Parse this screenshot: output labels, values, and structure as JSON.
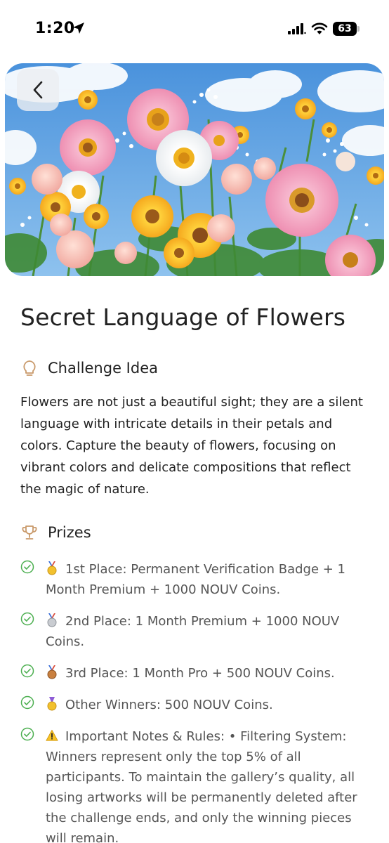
{
  "status_bar": {
    "time": "1:20",
    "battery": "63"
  },
  "header": {
    "back_label": "<"
  },
  "title": "Secret Language of Flowers",
  "challenge": {
    "heading": "Challenge Idea",
    "icon": "lightbulb-icon",
    "description": "Flowers are not just a beautiful sight; they are a silent language with intricate details in their petals and colors. Capture the beauty of flowers, focusing on vibrant colors and delicate compositions that reflect the magic of nature."
  },
  "prizes": {
    "heading": "Prizes",
    "icon": "trophy-icon",
    "items": [
      {
        "icon": "gold-medal-icon",
        "text": "1st Place: Permanent Verification Badge + 1 Month Premium + 1000 NOUV Coins."
      },
      {
        "icon": "silver-medal-icon",
        "text": "2nd Place: 1 Month Premium + 1000 NOUV Coins."
      },
      {
        "icon": "bronze-medal-icon",
        "text": "3rd Place: 1 Month Pro + 500 NOUV Coins."
      },
      {
        "icon": "medal-icon",
        "text": "Other Winners: 500 NOUV Coins."
      },
      {
        "icon": "warning-icon",
        "text": "Important Notes & Rules: • Filtering System: Winners represent only the top 5% of all participants. To maintain the gallery’s quality, all losing artworks will be permanently deleted after the challenge ends, and only the winning pieces will remain."
      }
    ]
  },
  "colors": {
    "accent": "#c99a6b",
    "check": "#4caf50",
    "text": "#222222",
    "muted_text": "#555555"
  }
}
